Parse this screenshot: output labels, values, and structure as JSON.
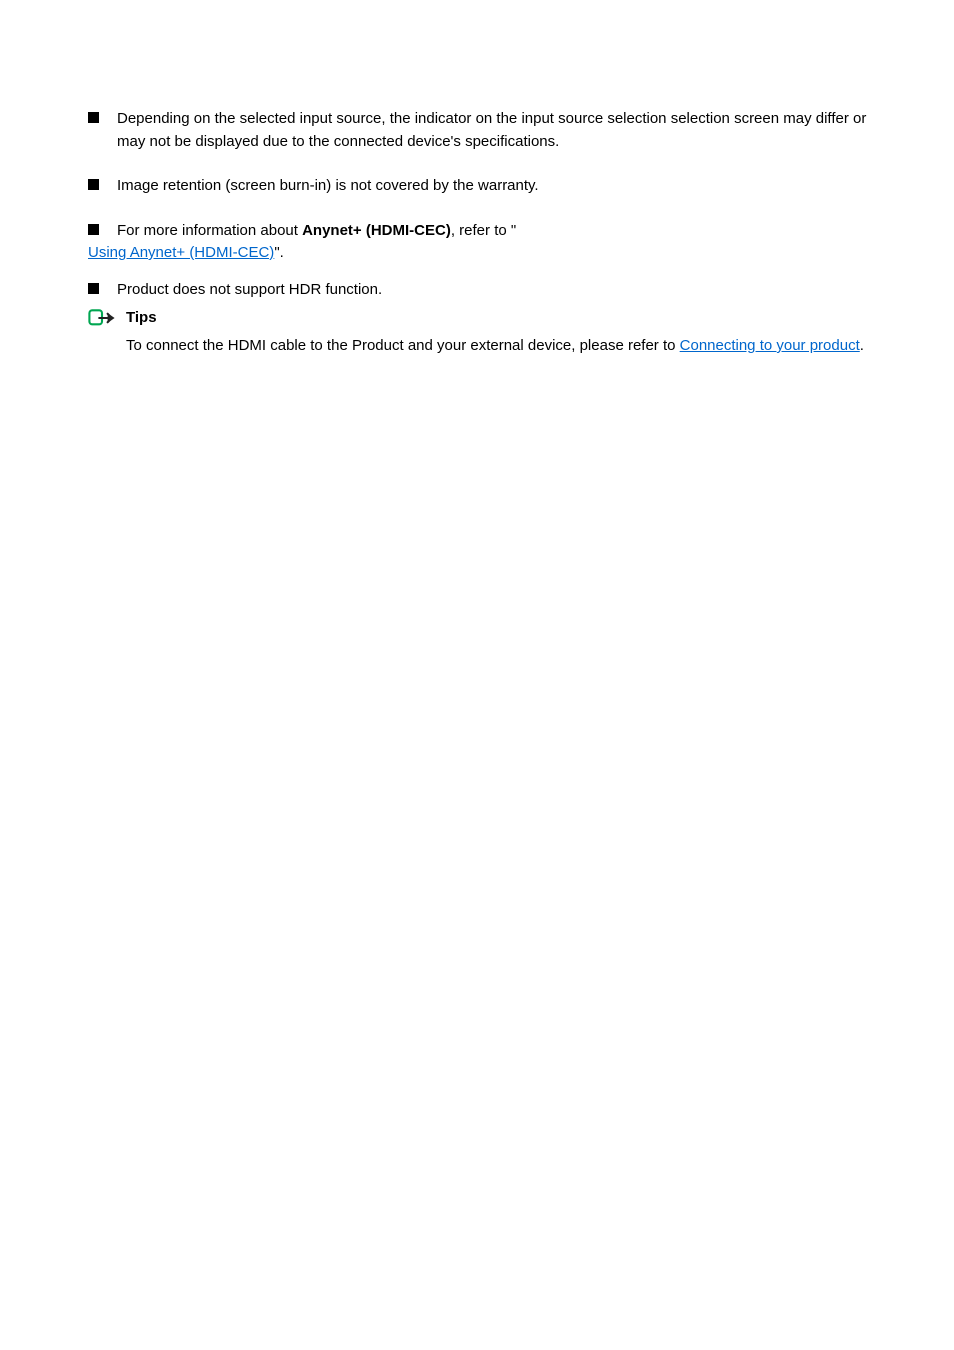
{
  "bullets": [
    {
      "text": "Depending on the selected input source, the indicator on the input source selection selection screen may differ or may not be displayed due to the connected device's specifications.",
      "className": "item1"
    },
    {
      "text": "Image retention (screen burn-in) is not covered by the warranty.",
      "className": "item2"
    }
  ],
  "item3": {
    "prefix": "For more information about ",
    "bold": "Anynet+ (HDMI-CEC)",
    "suffix": ", refer to \""
  },
  "link1": "Using Anynet+ (HDMI-CEC)",
  "item3end": "\".",
  "item4": {
    "text": "Product does not support HDR function."
  },
  "tipLabel": "Tips",
  "tipContent": {
    "prefix": "To connect the HDMI cable to the Product and your external device, please refer to ",
    "link": "Connecting to your product",
    "suffix": "."
  }
}
